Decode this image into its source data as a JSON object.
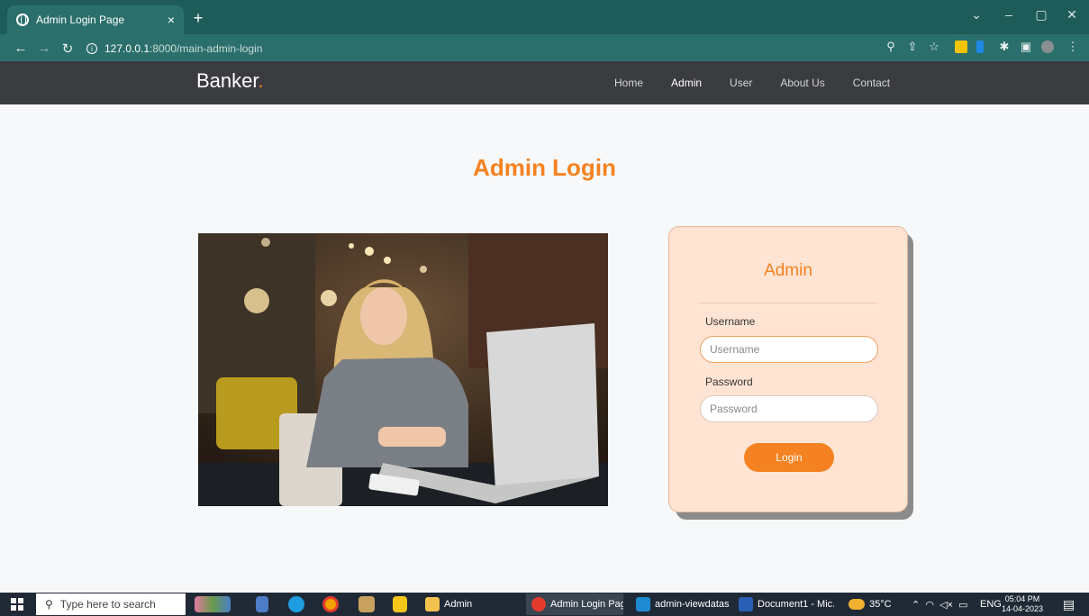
{
  "browser": {
    "tab_title": "Admin Login Page",
    "tab_close": "×",
    "new_tab": "+",
    "url_host": "127.0.0.1",
    "url_path": ":8000/main-admin-login",
    "window_controls": [
      "⌄",
      "–",
      "▢",
      "✕"
    ],
    "icons": [
      "back-arrow-icon",
      "forward-arrow-icon",
      "reload-icon",
      "info-icon",
      "zoom-icon",
      "share-icon",
      "star-icon",
      "extension-icon",
      "puzzle-icon",
      "sidepanel-icon",
      "profile-icon",
      "menu-icon"
    ]
  },
  "navbar": {
    "brand": "Banker",
    "brand_dot": ".",
    "links": [
      "Home",
      "Admin",
      "User",
      "About Us",
      "Contact"
    ],
    "active": "Admin"
  },
  "main": {
    "title": "Admin Login"
  },
  "form": {
    "heading": "Admin",
    "username_label": "Username",
    "username_placeholder": "Username",
    "password_label": "Password",
    "password_placeholder": "Password",
    "submit": "Login"
  },
  "taskbar": {
    "search_placeholder": "Type here to search",
    "tasks": [
      "Admin",
      "Admin Login Pag...",
      "admin-viewdatas...",
      "Document1 - Mic..."
    ],
    "weather": "35°C",
    "language": "ENG",
    "time": "05:04 PM",
    "date": "14-04-2023"
  },
  "colors": {
    "accent": "#f58220",
    "navbar_bg": "#3a3c40",
    "card_bg": "#ffe4d3",
    "browser_bar": "#2b6f6c"
  }
}
